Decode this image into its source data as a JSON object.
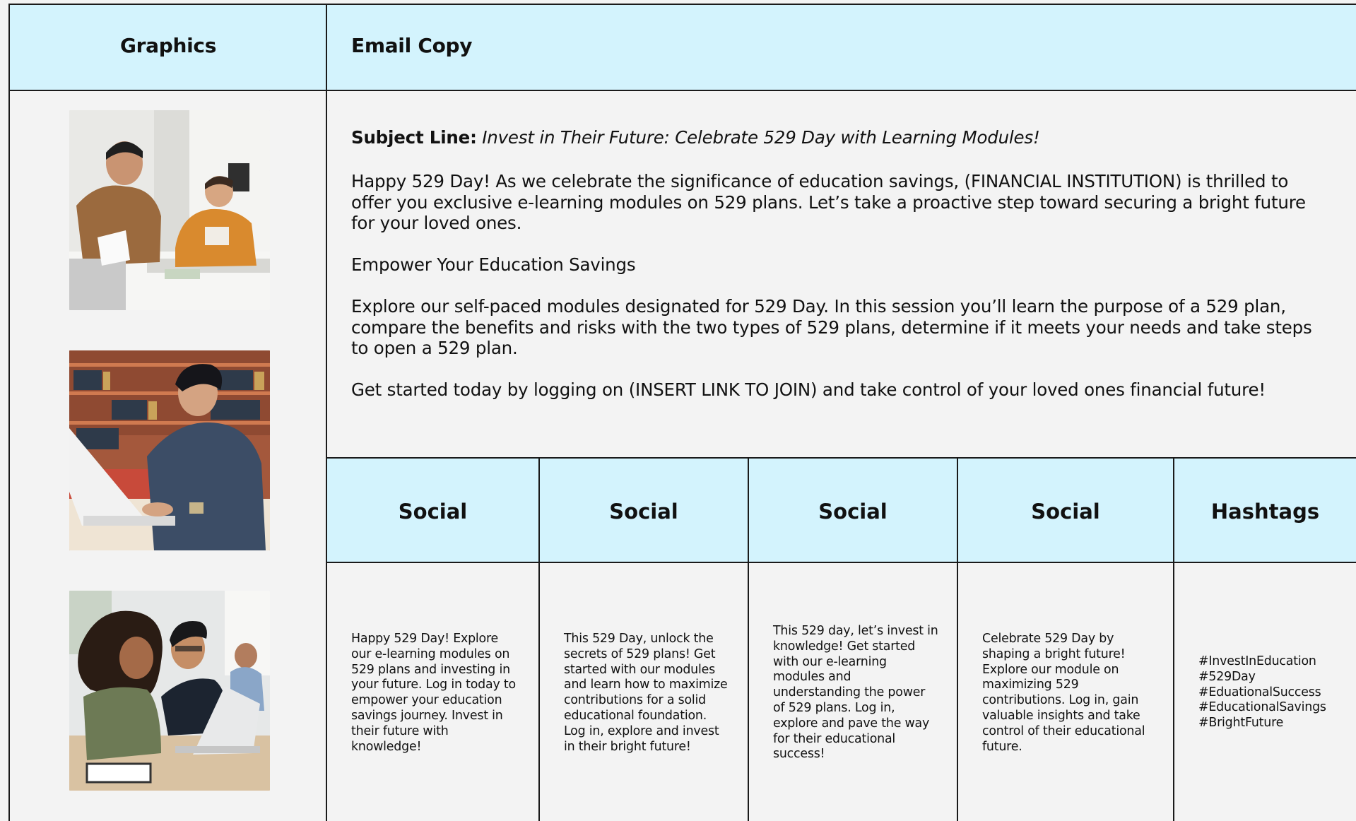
{
  "headers": {
    "graphics": "Graphics",
    "email_copy": "Email Copy"
  },
  "graphics": [
    {
      "name": "father-and-son-photo",
      "description_icon": "photo-image"
    },
    {
      "name": "young-man-laptop-photo",
      "description_icon": "photo-image"
    },
    {
      "name": "two-students-laptop-photo",
      "description_icon": "photo-image"
    }
  ],
  "email": {
    "subject_label": "Subject Line:",
    "subject_text": "Invest in Their Future: Celebrate 529 Day with Learning Modules!",
    "paragraph1": "Happy 529 Day! As we celebrate the significance of education savings, (FINANCIAL INSTITUTION) is thrilled to offer you exclusive e-learning modules on 529 plans.  Let’s take a proactive step toward securing a bright future for your loved ones.",
    "paragraph2": "Empower Your Education Savings",
    "paragraph3": "Explore our self-paced modules designated for 529 Day.  In this session you’ll learn the purpose of a 529 plan, compare the benefits and risks with the two types of 529 plans, determine if it meets your needs and take steps to open a 529 plan.",
    "paragraph4": "Get started today by logging on (INSERT LINK TO JOIN) and take control of your loved ones financial future!"
  },
  "social": {
    "headers": [
      "Social",
      "Social",
      "Social",
      "Social",
      "Hashtags"
    ],
    "posts": [
      "Happy 529 Day! Explore\nour e-learning modules on\n529 plans and investing in\nyour future. Log in today to\nempower your education\nsavings journey. Invest in\ntheir future with\nknowledge!",
      "This 529 Day, unlock the\nsecrets of 529 plans! Get\nstarted with our modules\nand learn how to maximize\ncontributions for a solid\neducational foundation.\nLog in, explore and invest\nin their bright future!",
      "This 529 day, let’s invest in\nknowledge! Get started\nwith our e-learning\nmodules and\nunderstanding the power\nof 529 plans. Log in,\nexplore and pave the way\nfor their educational\nsuccess!",
      "Celebrate 529 Day by\nshaping a bright future!\nExplore our module on\nmaximizing 529\ncontributions. Log in, gain\nvaluable insights and take\ncontrol of their educational\nfuture."
    ],
    "hashtags": "#InvestInEducation\n#529Day\n#EduationalSuccess\n#EducationalSavings\n#BrightFuture"
  },
  "colors": {
    "header_bg": "#d3f3fd",
    "body_bg": "#f3f3f3",
    "grid_line": "#1a1a1a"
  }
}
